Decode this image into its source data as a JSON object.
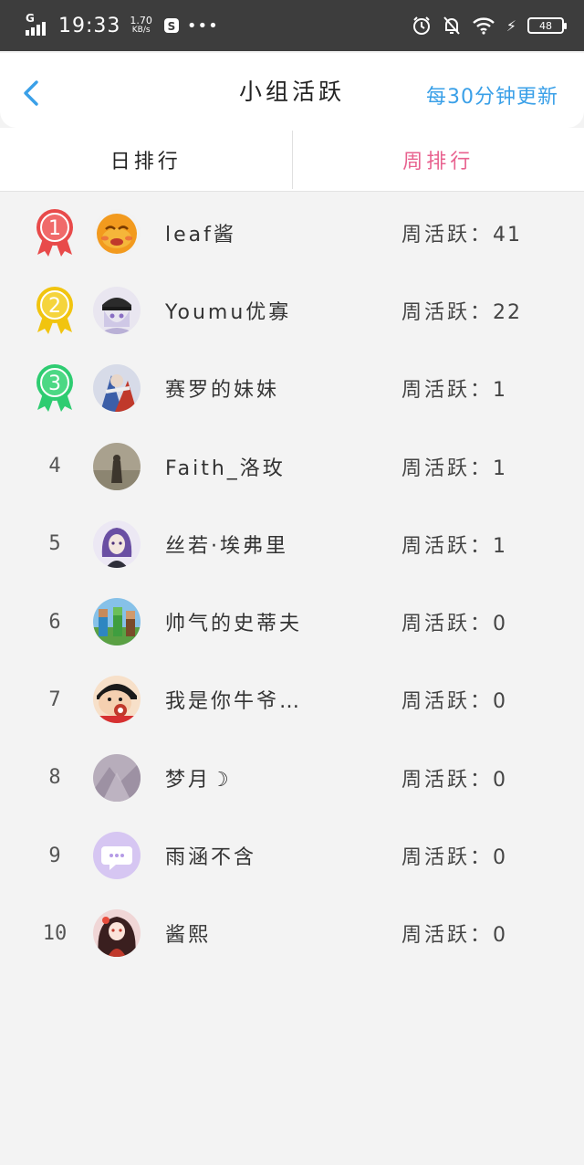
{
  "status_bar": {
    "network": "G",
    "time": "19:33",
    "speed_value": "1.70",
    "speed_unit": "KB/s",
    "more": "•••",
    "battery": "48"
  },
  "header": {
    "title": "小组活跃",
    "refresh_note": "每30分钟更新"
  },
  "tabs": [
    {
      "label": "日排行"
    },
    {
      "label": "周排行",
      "active": true
    }
  ],
  "colors": {
    "accent_blue": "#3aa0e8",
    "accent_pink": "#e8628f",
    "medal_gold": "#f1c40f",
    "medal_red": "#e84a4a",
    "medal_green": "#2ecc71"
  },
  "activity_label": "周活跃：",
  "ranking": [
    {
      "rank": "1",
      "name": "leaf酱",
      "value": "41",
      "medal": "red"
    },
    {
      "rank": "2",
      "name": "Youmu优寡",
      "value": "22",
      "medal": "gold"
    },
    {
      "rank": "3",
      "name": "赛罗的妹妹",
      "value": "1",
      "medal": "green"
    },
    {
      "rank": "4",
      "name": "Faith_洛玫",
      "value": "1"
    },
    {
      "rank": "5",
      "name": "丝若·埃弗里",
      "value": "1"
    },
    {
      "rank": "6",
      "name": "帅气的史蒂夫",
      "value": "0"
    },
    {
      "rank": "7",
      "name": "我是你牛爷…",
      "value": "0"
    },
    {
      "rank": "8",
      "name": "梦月☽",
      "value": "0"
    },
    {
      "rank": "9",
      "name": "雨涵不含",
      "value": "0"
    },
    {
      "rank": "10",
      "name": "酱熙",
      "value": "0"
    }
  ]
}
